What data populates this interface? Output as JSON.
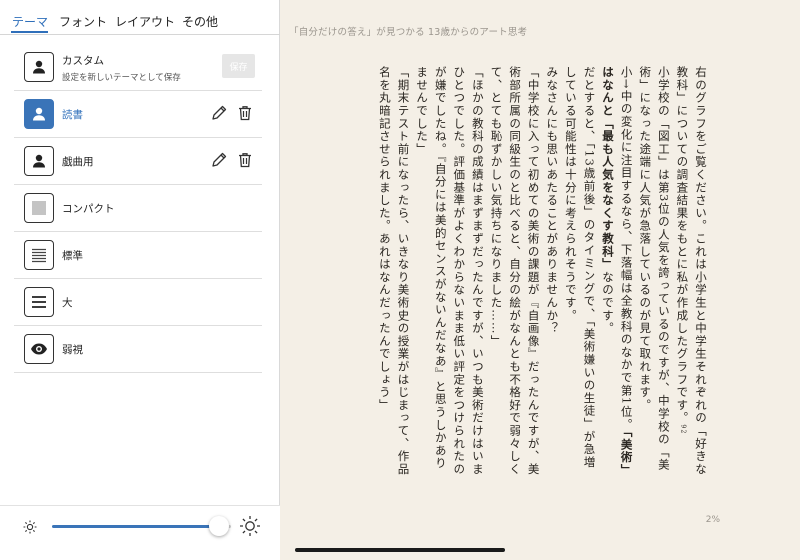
{
  "tabs": [
    {
      "label": "テーマ",
      "active": true
    },
    {
      "label": "フォント"
    },
    {
      "label": "レイアウト"
    },
    {
      "label": "その他"
    }
  ],
  "themes": [
    {
      "label": "カスタム",
      "sublabel": "設定を新しいテーマとして保存",
      "icon": "person-icon",
      "save_label": "保存"
    },
    {
      "label": "読書",
      "icon": "person-icon",
      "selected": true,
      "edit_icon": "pencil-icon",
      "delete_icon": "trash-icon"
    },
    {
      "label": "戯曲用",
      "icon": "person-icon",
      "edit_icon": "pencil-icon",
      "delete_icon": "trash-icon"
    },
    {
      "label": "コンパクト",
      "icon": "compact-lines-icon"
    },
    {
      "label": "標準",
      "icon": "standard-lines-icon"
    },
    {
      "label": "大",
      "icon": "large-lines-icon"
    },
    {
      "label": "弱視",
      "icon": "eye-icon"
    }
  ],
  "brightness": {
    "level": 0.93,
    "min_icon": "sun-small-icon",
    "max_icon": "sun-large-icon"
  },
  "reader": {
    "book_title": "「自分だけの答え」が見つかる 13歳からのアート思考",
    "footnote_marker": "92",
    "progress": "2%",
    "paragraphs": {
      "p1": "右のグラフをご覧ください。これは小学生と中学生それぞれの「好きな教科」についての調査結果をもとに私が作成したグラフです。",
      "p2a": "小学校の「図工」は第3位の人気を誇っているのですが、中学校の「美術」になった途端に人気が急落しているのが見て取れます。",
      "p3a": "小→中の変化に注目するなら、下落幅は全教科のなかで第1位。",
      "p3b": "「美術」はなんと「最も人気をなくす教科」",
      "p3c": "なのです。",
      "p4": "だとすると、「13歳前後」のタイミングで、「美術嫌いの生徒」が急増している可能性は十分に考えられそうです。",
      "p5": "みなさんにも思いあたることがありませんか？",
      "p6": "「中学校に入って初めての美術の課題が『自画像』だったんですが、美術部所属の同級生のと比べると、自分の絵がなんとも不格好で弱々しくて、とても恥ずかしい気持ちになりました……」",
      "p7": "「ほかの教科の成績はまずまずだったんですが、いつも美術だけはいまひとつでした。評価基準がよくわからないまま低い評定をつけられたのが嫌でしたね。『自分には美的センスがないんだなあ』と思うしかありませんでした」",
      "p8": "「期末テスト前になったら、いきなり美術史の授業がはじまって、作品名を丸暗記させられました。あれはなんだったんでしょう」"
    }
  },
  "colors": {
    "accent": "#2f6fba",
    "page_background": "#f4efe6"
  }
}
